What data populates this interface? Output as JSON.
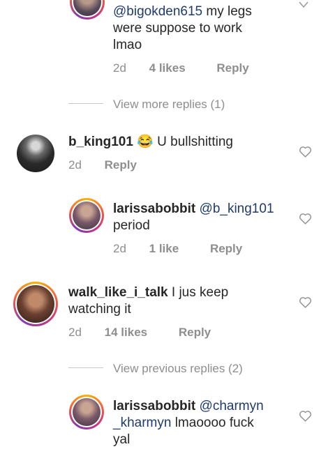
{
  "top_reply": {
    "line1_mention": "@bigokden615",
    "line1_rest": " my legs",
    "line2": "were suppose to work",
    "line3": "lmao",
    "time": "2d",
    "likes": "4 likes",
    "reply": "Reply"
  },
  "view_more_replies": "View more replies (1)",
  "comment_bking": {
    "username": "b_king101",
    "emoji": "😂",
    "text": " U bullshitting",
    "time": "2d",
    "reply": "Reply"
  },
  "reply_larissa_1": {
    "username": "larissabobbit",
    "mention": "@b_king101",
    "line2": "period",
    "time": "2d",
    "likes": "1 like",
    "reply": "Reply"
  },
  "comment_walk": {
    "username": "walk_like_i_talk",
    "text": " I jus keep",
    "line2": "watching it",
    "time": "2d",
    "likes": "14 likes",
    "reply": "Reply"
  },
  "view_previous_replies": "View previous replies (2)",
  "reply_larissa_2": {
    "username": "larissabobbit",
    "mention1": "@charmyn",
    "mention2": "_kharmyn",
    "rest": " lmaoooo fuck",
    "line3": "yal"
  },
  "colors": {
    "mention": "#1f3b6b",
    "meta": "#8e8e8e",
    "text": "#262626"
  }
}
